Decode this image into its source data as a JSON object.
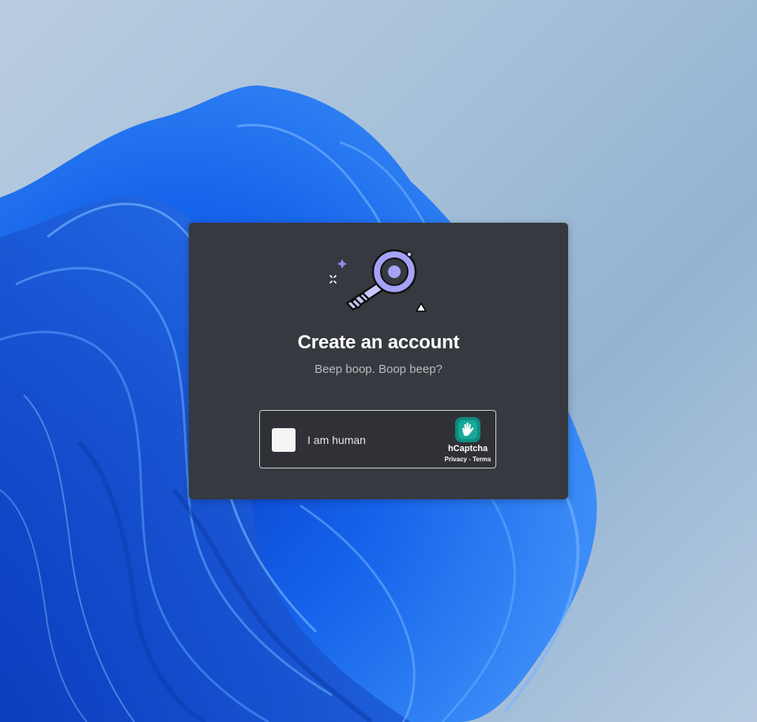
{
  "modal": {
    "title": "Create an account",
    "subtitle": "Beep boop. Boop beep?"
  },
  "captcha": {
    "label": "I am human",
    "brand": "hCaptcha",
    "privacy_link": "Privacy",
    "separator": " - ",
    "terms_link": "Terms"
  },
  "colors": {
    "modal_bg": "#36393f",
    "title": "#ffffff",
    "subtitle": "#b9bbbe",
    "key_accent": "#a5a3f5",
    "hcaptcha_teal": "#0e8a7f",
    "wallpaper_bloom": "#1a63e6"
  },
  "icons": {
    "illustration": "key-icon",
    "captcha_brand": "hcaptcha-hand-icon"
  }
}
